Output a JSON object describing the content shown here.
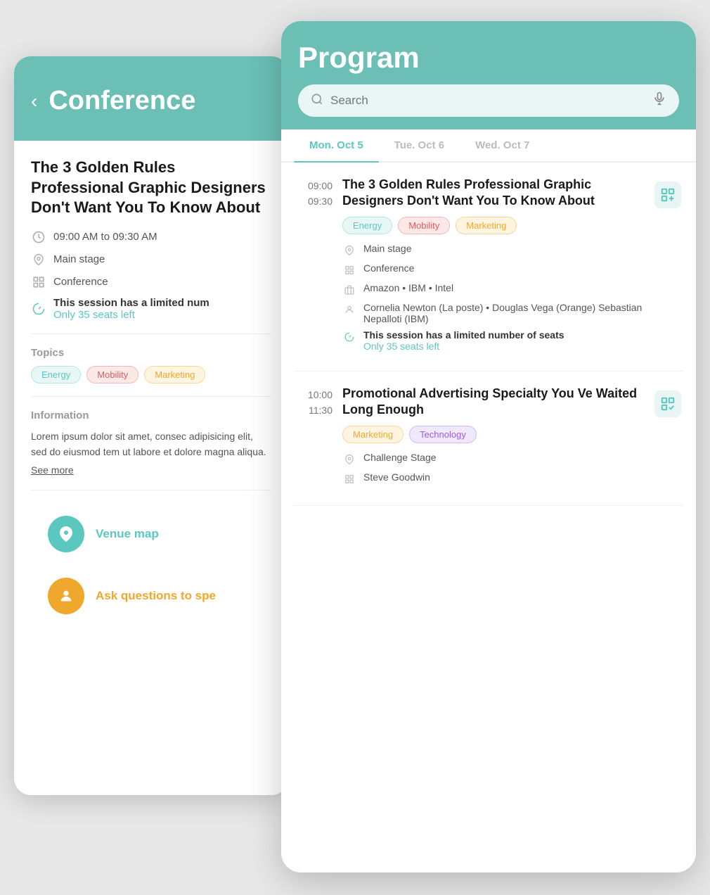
{
  "backCard": {
    "header": {
      "back_label": "<",
      "title": "Conference"
    },
    "session": {
      "title": "The 3 Golden Rules Professional Graphic Designers Don't Want You To Know About",
      "time": "09:00 AM to 09:30 AM",
      "location": "Main stage",
      "category": "Conference",
      "limited_label": "This session has a limited num",
      "seats_left": "Only 35 seats left"
    },
    "topics": {
      "label": "Topics",
      "tags": [
        "Energy",
        "Mobility",
        "Marketing"
      ]
    },
    "information": {
      "label": "Information",
      "text": "Lorem ipsum dolor sit amet, consec adipisicing elit, sed do eiusmod tem ut labore et dolore magna aliqua.",
      "see_more": "See more"
    },
    "actions": [
      {
        "label": "Venue map",
        "color": "#5bc8c0",
        "icon": "📍"
      },
      {
        "label": "Ask questions to spe",
        "color": "#f0a82c",
        "icon": "👤"
      }
    ]
  },
  "frontCard": {
    "header": {
      "title": "Program",
      "search_placeholder": "Search"
    },
    "tabs": [
      {
        "label": "Mon. Oct 5",
        "active": true
      },
      {
        "label": "Tue. Oct 6",
        "active": false
      },
      {
        "label": "Wed. Oct 7",
        "active": false
      }
    ],
    "sessions": [
      {
        "time_start": "09:00",
        "time_end": "09:30",
        "title": "The 3 Golden Rules Professional Graphic Designers Don't Want You To Know About",
        "tags": [
          {
            "label": "Energy",
            "type": "energy"
          },
          {
            "label": "Mobility",
            "type": "mobility"
          },
          {
            "label": "Marketing",
            "type": "marketing"
          }
        ],
        "location": "Main stage",
        "category": "Conference",
        "sponsors": "Amazon • IBM • Intel",
        "speakers": "Cornelia Newton (La poste) • Douglas Vega (Orange) Sebastian Nepalloti (IBM)",
        "limited_label": "This session has a limited number of seats",
        "seats_left": "Only 35 seats left",
        "added": false
      },
      {
        "time_start": "10:00",
        "time_end": "11:30",
        "title": "Promotional Advertising Specialty You Ve Waited Long Enough",
        "tags": [
          {
            "label": "Marketing",
            "type": "marketing"
          },
          {
            "label": "Technology",
            "type": "technology"
          }
        ],
        "location": "Challenge Stage",
        "category": "Steve Goodwin",
        "sponsors": "",
        "speakers": "",
        "limited_label": "",
        "seats_left": "",
        "added": true
      }
    ]
  }
}
